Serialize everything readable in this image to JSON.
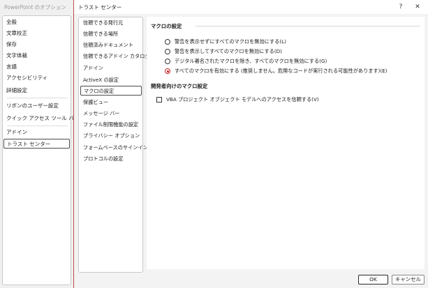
{
  "options_window": {
    "title": "PowerPoint のオプション",
    "items": [
      "全般",
      "文章校正",
      "保存",
      "文字体裁",
      "言語",
      "アクセシビリティ",
      "詳細設定",
      "リボンのユーザー設定",
      "クイック アクセス ツール バー",
      "アドイン",
      "トラスト センター"
    ],
    "selected": "トラスト センター"
  },
  "dialog": {
    "title": "トラスト センター",
    "help_label": "?",
    "close_label": "✕"
  },
  "nav": {
    "items": [
      "信頼できる発行元",
      "信頼できる場所",
      "信頼済みドキュメント",
      "信頼できるアドイン カタログ",
      "アドイン",
      "ActiveX の設定",
      "マクロの設定",
      "保護ビュー",
      "メッセージ バー",
      "ファイル制限機能の設定",
      "プライバシー オプション",
      "フォームベースのサインイン",
      "プロトコルの設定"
    ],
    "selected": "マクロの設定"
  },
  "macro_settings": {
    "heading": "マクロの設定",
    "options": [
      "警告を表示せずにすべてのマクロを無効にする(L)",
      "警告を表示してすべてのマクロを無効にする(D)",
      "デジタル署名されたマクロを除き、すべてのマクロを無効にする(G)",
      "すべてのマクロを有効にする (推奨しません。危険なコードが実行される可能性があります)(E)"
    ],
    "selected_index": 3
  },
  "developer_settings": {
    "heading": "開発者向けのマクロ設定",
    "vba_access_label": "VBA プロジェクト オブジェクト モデルへのアクセスを信頼する(V)",
    "vba_access_checked": false
  },
  "footer": {
    "ok_label": "OK",
    "cancel_label": "キャンセル"
  }
}
